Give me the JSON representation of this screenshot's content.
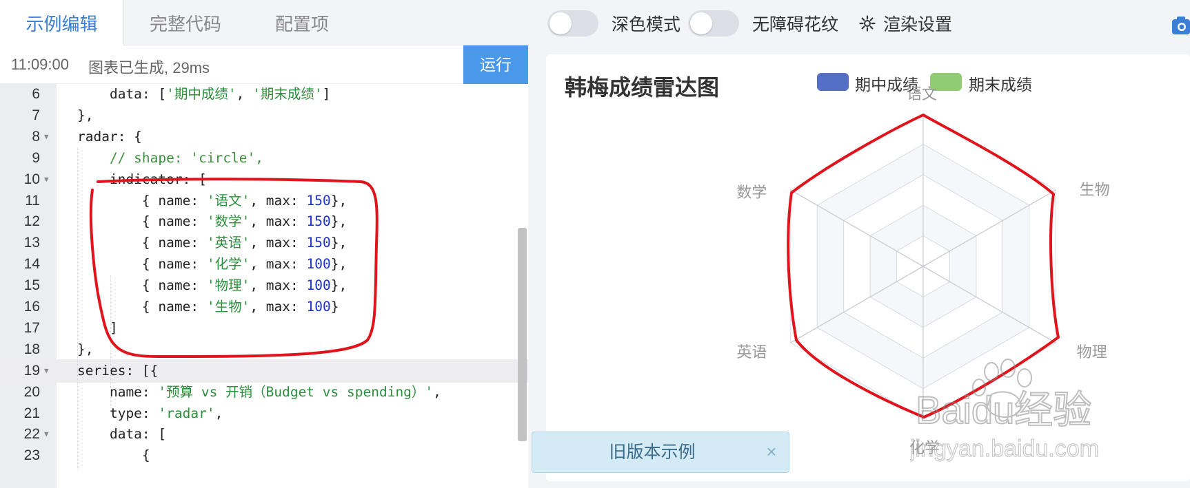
{
  "editor": {
    "tabs": [
      {
        "label": "示例编辑"
      },
      {
        "label": "完整代码"
      },
      {
        "label": "配置项"
      }
    ],
    "status": {
      "time": "11:09:00",
      "message": "图表已生成, 29ms"
    },
    "run_label": "运行",
    "lines": [
      {
        "no": "6",
        "text": "    data: ['期中成绩', '期末成绩']"
      },
      {
        "no": "7",
        "text": "},"
      },
      {
        "no": "8",
        "text": "radar: {"
      },
      {
        "no": "9",
        "text": "    // shape: 'circle',"
      },
      {
        "no": "10",
        "text": "    indicator: ["
      },
      {
        "no": "11",
        "text": "        { name: '语文', max: 150},"
      },
      {
        "no": "12",
        "text": "        { name: '数学', max: 150},"
      },
      {
        "no": "13",
        "text": "        { name: '英语', max: 150},"
      },
      {
        "no": "14",
        "text": "        { name: '化学', max: 100},"
      },
      {
        "no": "15",
        "text": "        { name: '物理', max: 100},"
      },
      {
        "no": "16",
        "text": "        { name: '生物', max: 100}"
      },
      {
        "no": "17",
        "text": "    ]"
      },
      {
        "no": "18",
        "text": "},"
      },
      {
        "no": "19",
        "text": "series: [{"
      },
      {
        "no": "20",
        "text": "    name: '预算 vs 开销（Budget vs spending）',"
      },
      {
        "no": "21",
        "text": "    type: 'radar',"
      },
      {
        "no": "22",
        "text": "    data: ["
      },
      {
        "no": "23",
        "text": "        {"
      }
    ]
  },
  "toolbar": {
    "dark_mode_label": "深色模式",
    "a11y_pattern_label": "无障碍花纹",
    "render_settings_label": "渲染设置"
  },
  "chart_data": {
    "type": "radar",
    "title": "韩梅成绩雷达图",
    "legend": [
      {
        "name": "期中成绩",
        "color": "#5470c6"
      },
      {
        "name": "期末成绩",
        "color": "#91cc75"
      }
    ],
    "indicators": [
      {
        "name": "语文",
        "max": 150
      },
      {
        "name": "数学",
        "max": 150
      },
      {
        "name": "英语",
        "max": 150
      },
      {
        "name": "化学",
        "max": 100
      },
      {
        "name": "物理",
        "max": 100
      },
      {
        "name": "生物",
        "max": 100
      }
    ],
    "split_number": 5,
    "series": []
  },
  "banner": {
    "label": "旧版本示例",
    "close": "×"
  },
  "watermark": {
    "text": "Baidu经验",
    "url": "jingyan.baidu.com"
  },
  "colors": {
    "accent": "#3a7fd5",
    "run_button": "#4a98ea",
    "annotation": "#e0141c"
  }
}
